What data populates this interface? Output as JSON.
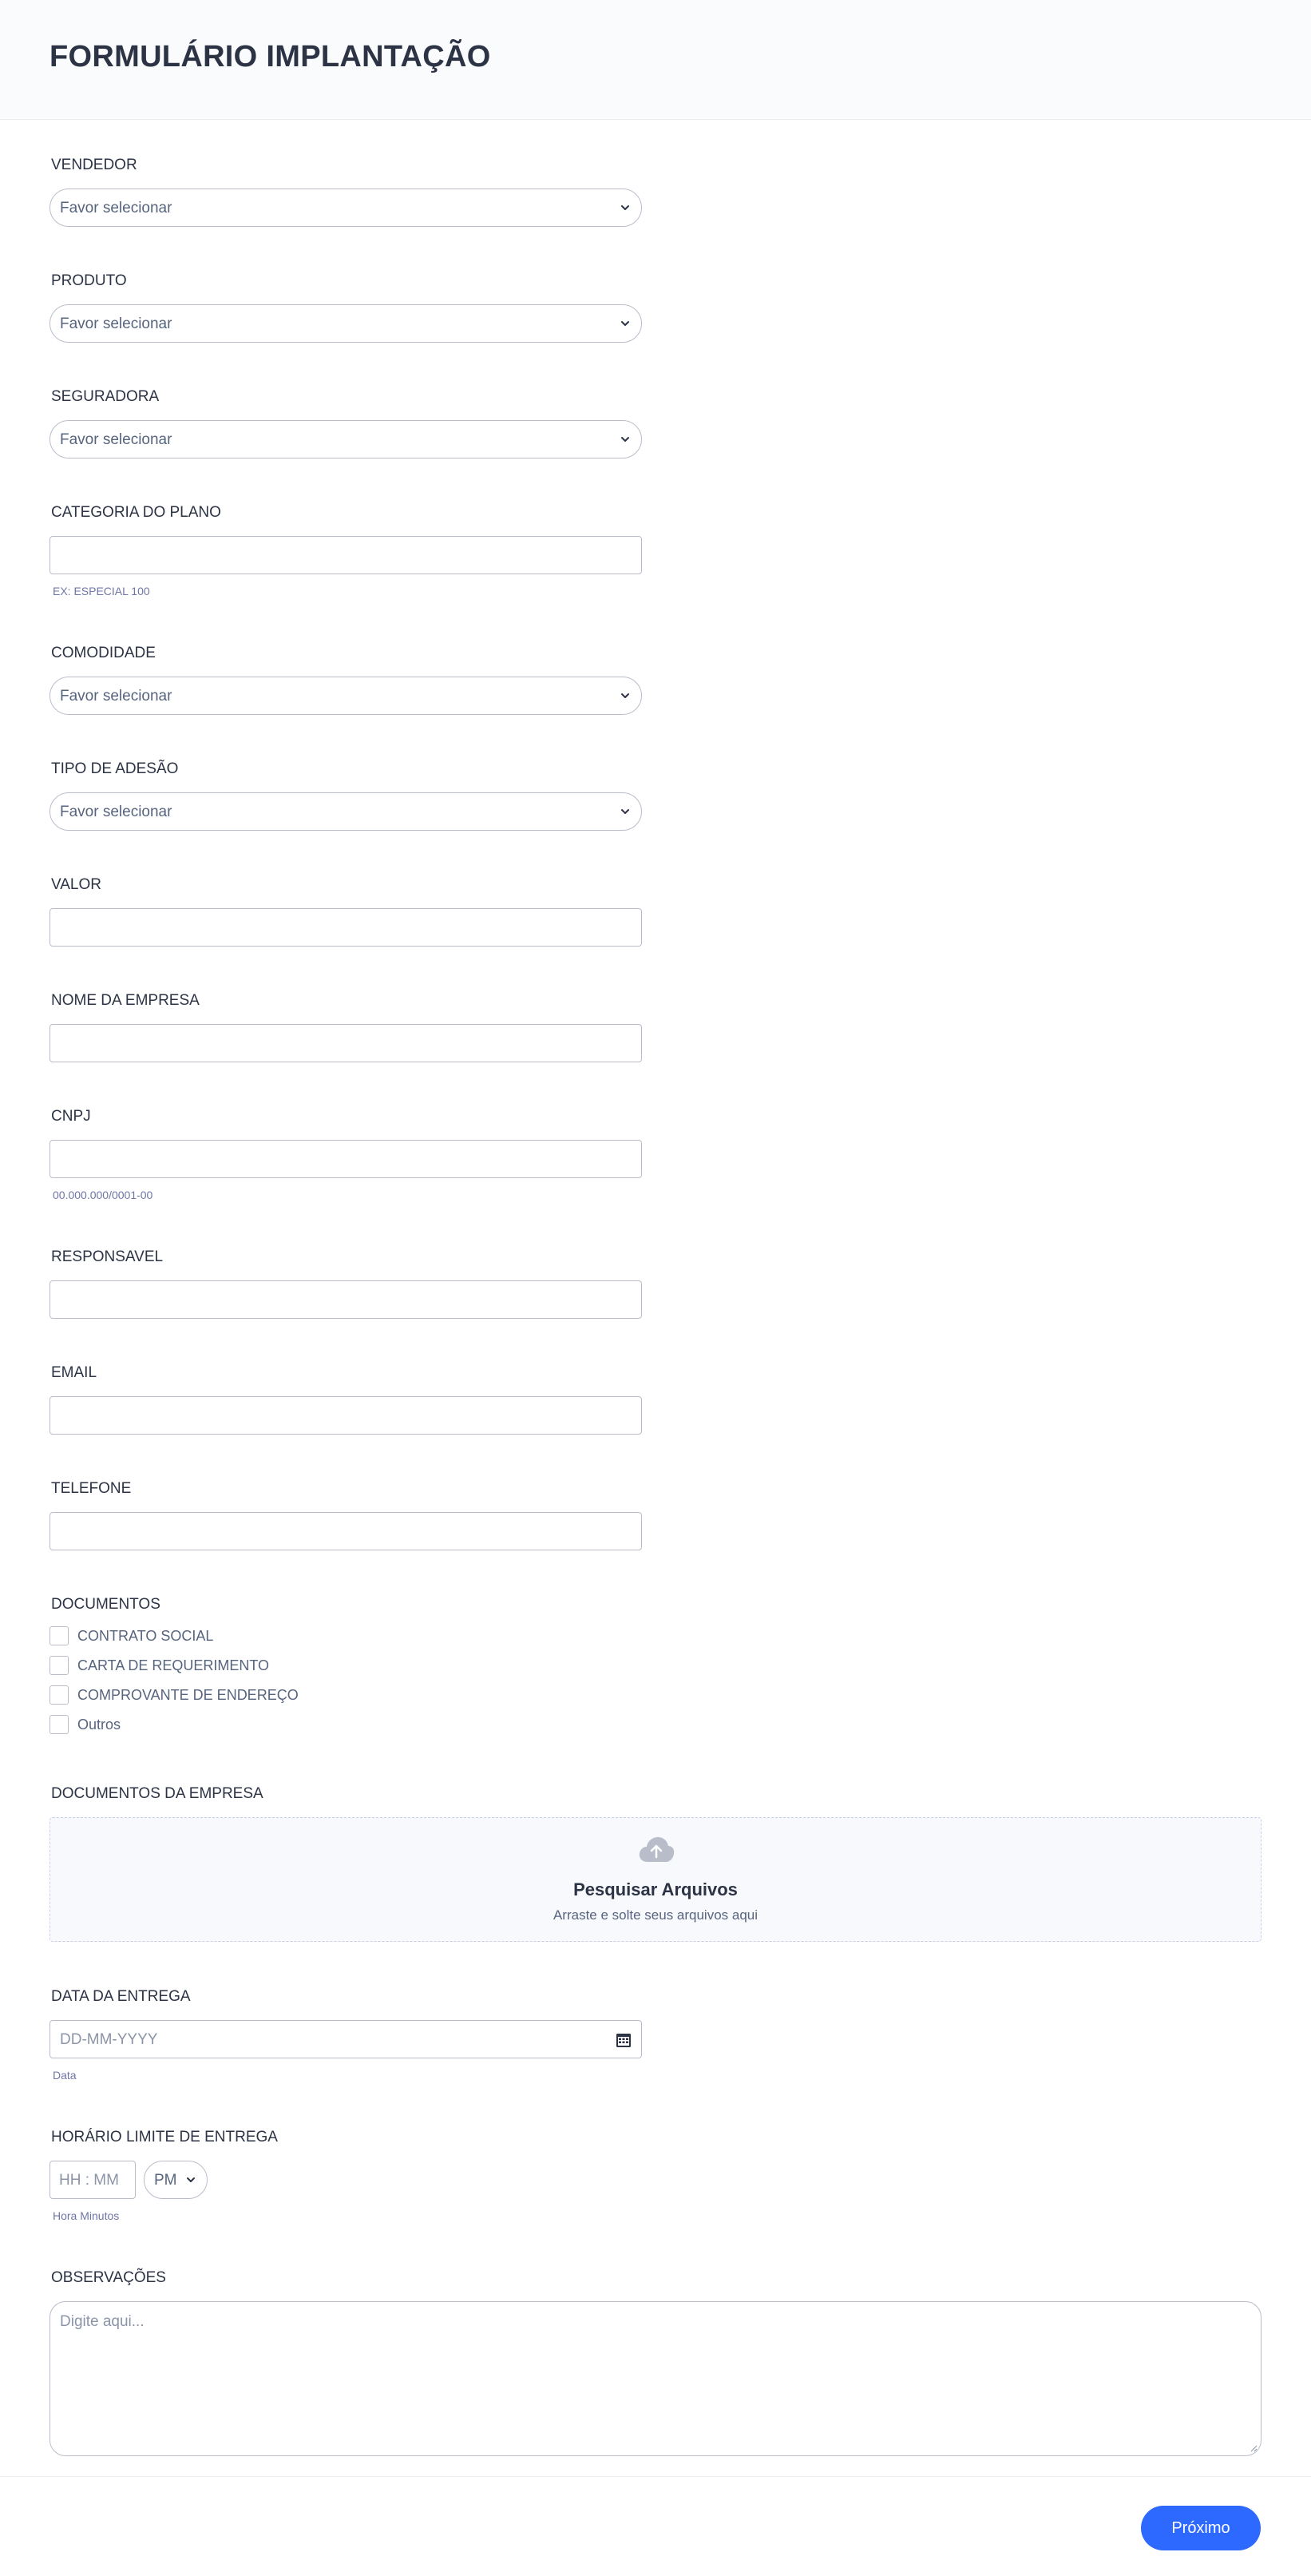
{
  "form": {
    "title": "FORMULÁRIO IMPLANTAÇÃO"
  },
  "fields": {
    "vendedor": {
      "label": "VENDEDOR",
      "value": "Favor selecionar"
    },
    "produto": {
      "label": "PRODUTO",
      "value": "Favor selecionar"
    },
    "seguradora": {
      "label": "SEGURADORA",
      "value": "Favor selecionar"
    },
    "categoria": {
      "label": "CATEGORIA DO PLANO",
      "value": "",
      "sublabel": "EX: ESPECIAL 100"
    },
    "comodidade": {
      "label": "COMODIDADE",
      "value": "Favor selecionar"
    },
    "tipo_adesao": {
      "label": "TIPO DE ADESÃO",
      "value": "Favor selecionar"
    },
    "valor": {
      "label": "VALOR",
      "value": ""
    },
    "nome_empresa": {
      "label": "NOME DA EMPRESA",
      "value": ""
    },
    "cnpj": {
      "label": "CNPJ",
      "value": "",
      "sublabel": "00.000.000/0001-00"
    },
    "responsavel": {
      "label": "RESPONSAVEL",
      "value": ""
    },
    "email": {
      "label": "EMAIL",
      "value": ""
    },
    "telefone": {
      "label": "TELEFONE",
      "value": ""
    },
    "documentos": {
      "label": "DOCUMENTOS",
      "options": [
        "CONTRATO SOCIAL",
        "CARTA DE REQUERIMENTO",
        "COMPROVANTE DE ENDEREÇO",
        "Outros"
      ]
    },
    "documentos_empresa": {
      "label": "DOCUMENTOS DA EMPRESA",
      "upload_title": "Pesquisar Arquivos",
      "upload_sub": "Arraste e solte seus arquivos aqui"
    },
    "data_entrega": {
      "label": "DATA DA ENTREGA",
      "placeholder": "DD-MM-YYYY",
      "sublabel": "Data"
    },
    "horario": {
      "label": "HORÁRIO LIMITE DE ENTREGA",
      "placeholder": "HH : MM",
      "ampm": "PM",
      "sublabel": "Hora Minutos"
    },
    "observacoes": {
      "label": "OBSERVAÇÕES",
      "placeholder": "Digite aqui..."
    }
  },
  "footer": {
    "next_label": "Próximo"
  },
  "colors": {
    "accent": "#2e69ff",
    "text": "#2c3345",
    "muted": "#57647e",
    "border": "#b8bdc9"
  },
  "icons": [
    "chevron-down-icon",
    "upload-cloud-icon",
    "calendar-icon",
    "resize-handle-icon"
  ]
}
